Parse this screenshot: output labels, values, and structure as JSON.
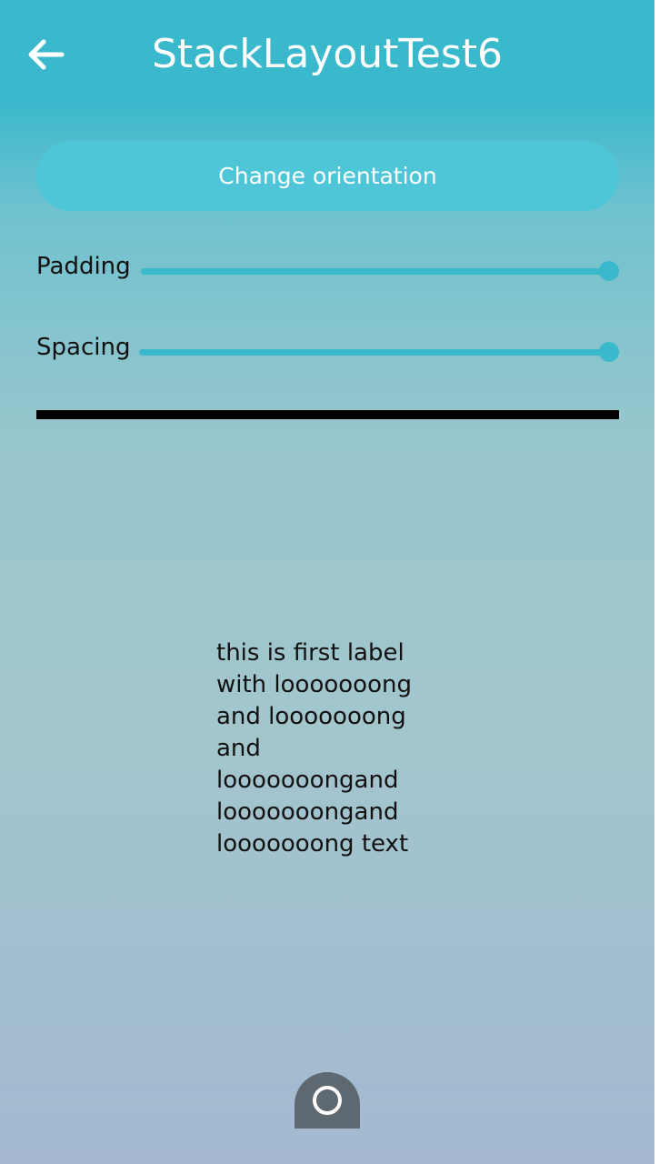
{
  "header": {
    "title": "StackLayoutTest6",
    "back_icon": "arrow-left-icon"
  },
  "controls": {
    "orientation_button_label": "Change orientation",
    "padding": {
      "label": "Padding",
      "value_fraction": 1.0
    },
    "spacing": {
      "label": "Spacing",
      "value_fraction": 1.0
    }
  },
  "content": {
    "first_label": "this is first label\nwith looooooong\nand looooooong\nand\nlooooooongand\nlooooooongand\nlooooooong text"
  },
  "navigation": {
    "home_icon": "home-circle-icon"
  },
  "colors": {
    "accent": "#3ab8cc",
    "button": "#4fc6d8",
    "divider": "#000000",
    "home_button": "#5d6870"
  }
}
